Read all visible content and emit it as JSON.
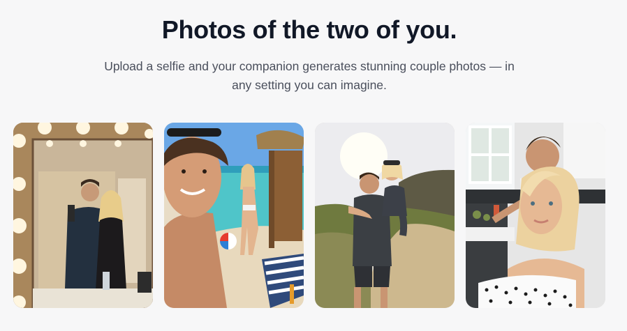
{
  "hero": {
    "title": "Photos of the two of you.",
    "subtitle_line1": "Upload a selfie and your companion generates stunning couple photos — in",
    "subtitle_line2": "any setting you can imagine."
  },
  "gallery": {
    "photos": [
      {
        "setting": "mirror-selfie"
      },
      {
        "setting": "beach"
      },
      {
        "setting": "hiking-trail"
      },
      {
        "setting": "kitchen"
      }
    ]
  },
  "colors": {
    "background": "#f7f7f8",
    "title": "#111827",
    "subtitle": "#4a4f5c"
  }
}
